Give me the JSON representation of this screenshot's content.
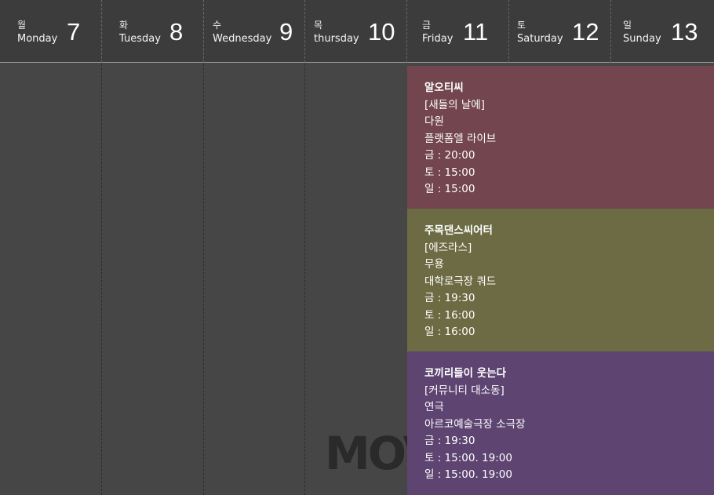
{
  "days": [
    {
      "kr": "월",
      "en": "Monday",
      "num": "7"
    },
    {
      "kr": "화",
      "en": "Tuesday",
      "num": "8"
    },
    {
      "kr": "수",
      "en": "Wednesday",
      "num": "9"
    },
    {
      "kr": "목",
      "en": "thursday",
      "num": "10"
    },
    {
      "kr": "금",
      "en": "Friday",
      "num": "11"
    },
    {
      "kr": "토",
      "en": "Saturday",
      "num": "12"
    },
    {
      "kr": "일",
      "en": "Sunday",
      "num": "13"
    }
  ],
  "events": [
    {
      "company": "알오티씨",
      "title": "[새들의 날에]",
      "genre": "다원",
      "venue": "플랫폼엘 라이브",
      "times": [
        "금 : 20:00",
        "토 : 15:00",
        "일 : 15:00"
      ],
      "color": "#72454f"
    },
    {
      "company": "주목댄스씨어터",
      "title": "[에즈라스]",
      "genre": "무용",
      "venue": "대학로극장 쿼드",
      "times": [
        "금 : 19:30",
        "토 : 16:00",
        "일 : 16:00"
      ],
      "color": "#6c6b43"
    },
    {
      "company": "코끼리들이 웃는다",
      "title": "[커뮤니티 대소동]",
      "genre": "연극",
      "venue": "아르코예술극장 소극장",
      "times": [
        "금 : 19:30",
        "토 : 15:00. 19:00",
        "일 : 15:00. 19:00"
      ],
      "color": "#5e4471"
    }
  ],
  "watermark": {
    "logo": "MOVE"
  }
}
